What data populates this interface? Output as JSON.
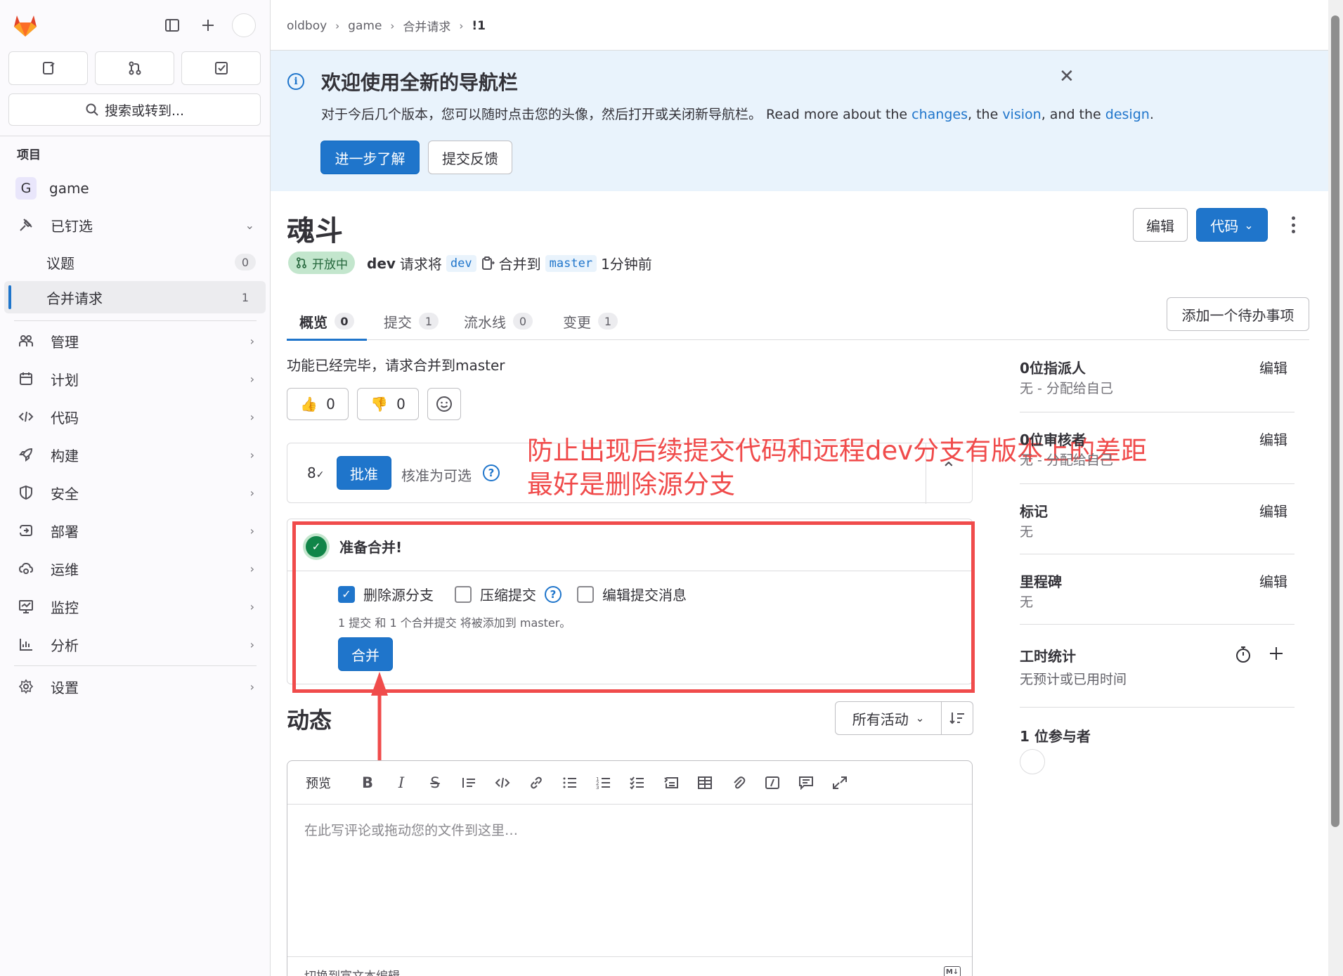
{
  "sidebar": {
    "search_label": "搜索或转到...",
    "section": "项目",
    "project": {
      "letter": "G",
      "name": "game"
    },
    "pinned": "已钉选",
    "pinned_items": [
      {
        "label": "议题",
        "count": "0"
      },
      {
        "label": "合并请求",
        "count": "1"
      }
    ],
    "nav": [
      {
        "label": "管理",
        "icon": "users-icon"
      },
      {
        "label": "计划",
        "icon": "calendar-icon"
      },
      {
        "label": "代码",
        "icon": "code-icon"
      },
      {
        "label": "构建",
        "icon": "rocket-icon"
      },
      {
        "label": "安全",
        "icon": "shield-icon"
      },
      {
        "label": "部署",
        "icon": "deploy-icon"
      },
      {
        "label": "运维",
        "icon": "cloud-gear-icon"
      },
      {
        "label": "监控",
        "icon": "monitor-icon"
      },
      {
        "label": "分析",
        "icon": "chart-icon"
      }
    ],
    "settings": "设置"
  },
  "breadcrumb": [
    "oldboy",
    "game",
    "合并请求",
    "!1"
  ],
  "banner": {
    "title": "欢迎使用全新的导航栏",
    "text_cn": "对于今后几个版本，您可以随时点击您的头像，然后打开或关闭新导航栏。 Read more about the ",
    "link_changes": "changes",
    "text_mid1": ", the ",
    "link_vision": "vision",
    "text_mid2": ", and the ",
    "link_design": "design",
    "text_end": ".",
    "primary_btn": "进一步了解",
    "secondary_btn": "提交反馈"
  },
  "mr": {
    "title": "魂斗",
    "status": "开放中",
    "author": "dev",
    "request_text": "请求将",
    "source_branch": "dev",
    "merge_into": "合并到",
    "target_branch": "master",
    "time": "1分钟前",
    "edit_btn": "编辑",
    "code_btn": "代码"
  },
  "tabs": [
    {
      "label": "概览",
      "count": "0"
    },
    {
      "label": "提交",
      "count": "1"
    },
    {
      "label": "流水线",
      "count": "0"
    },
    {
      "label": "变更",
      "count": "1"
    }
  ],
  "todo_btn": "添加一个待办事项",
  "description": "功能已经完毕，请求合并到master",
  "reactions": {
    "thumbs_up": "0",
    "thumbs_down": "0"
  },
  "approval": {
    "icon_text": "8",
    "approve_btn": "批准",
    "optional_text": "核准为可选"
  },
  "merge": {
    "ready": "准备合并!",
    "delete_source": "删除源分支",
    "squash": "压缩提交",
    "edit_message": "编辑提交消息",
    "note": "1 提交 和 1 个合并提交 将被添加到 master。",
    "merge_btn": "合并"
  },
  "annotation": {
    "line1": "防止出现后续提交代码和远程dev分支有版本上的差距",
    "line2": "最好是删除源分支",
    "color": "#f04b4b"
  },
  "activity": {
    "title": "动态",
    "filter": "所有活动"
  },
  "editor": {
    "preview": "预览",
    "placeholder": "在此写评论或拖动您的文件到这里…",
    "switch_text": "切换到富文本编辑"
  },
  "right_sidebar": {
    "assignee_title": "0位指派人",
    "assignee_value": "无 - 分配给自己",
    "reviewer_title": "0位审核者",
    "reviewer_value": "无 - 分配给自己",
    "labels_title": "标记",
    "labels_value": "无",
    "milestone_title": "里程碑",
    "milestone_value": "无",
    "time_title": "工时统计",
    "time_value": "无预计或已用时间",
    "participants_title": "1 位参与者",
    "edit": "编辑"
  },
  "colors": {
    "accent": "#1f75cb",
    "status_green": "#108548",
    "annotation_red": "#f04b4b"
  }
}
